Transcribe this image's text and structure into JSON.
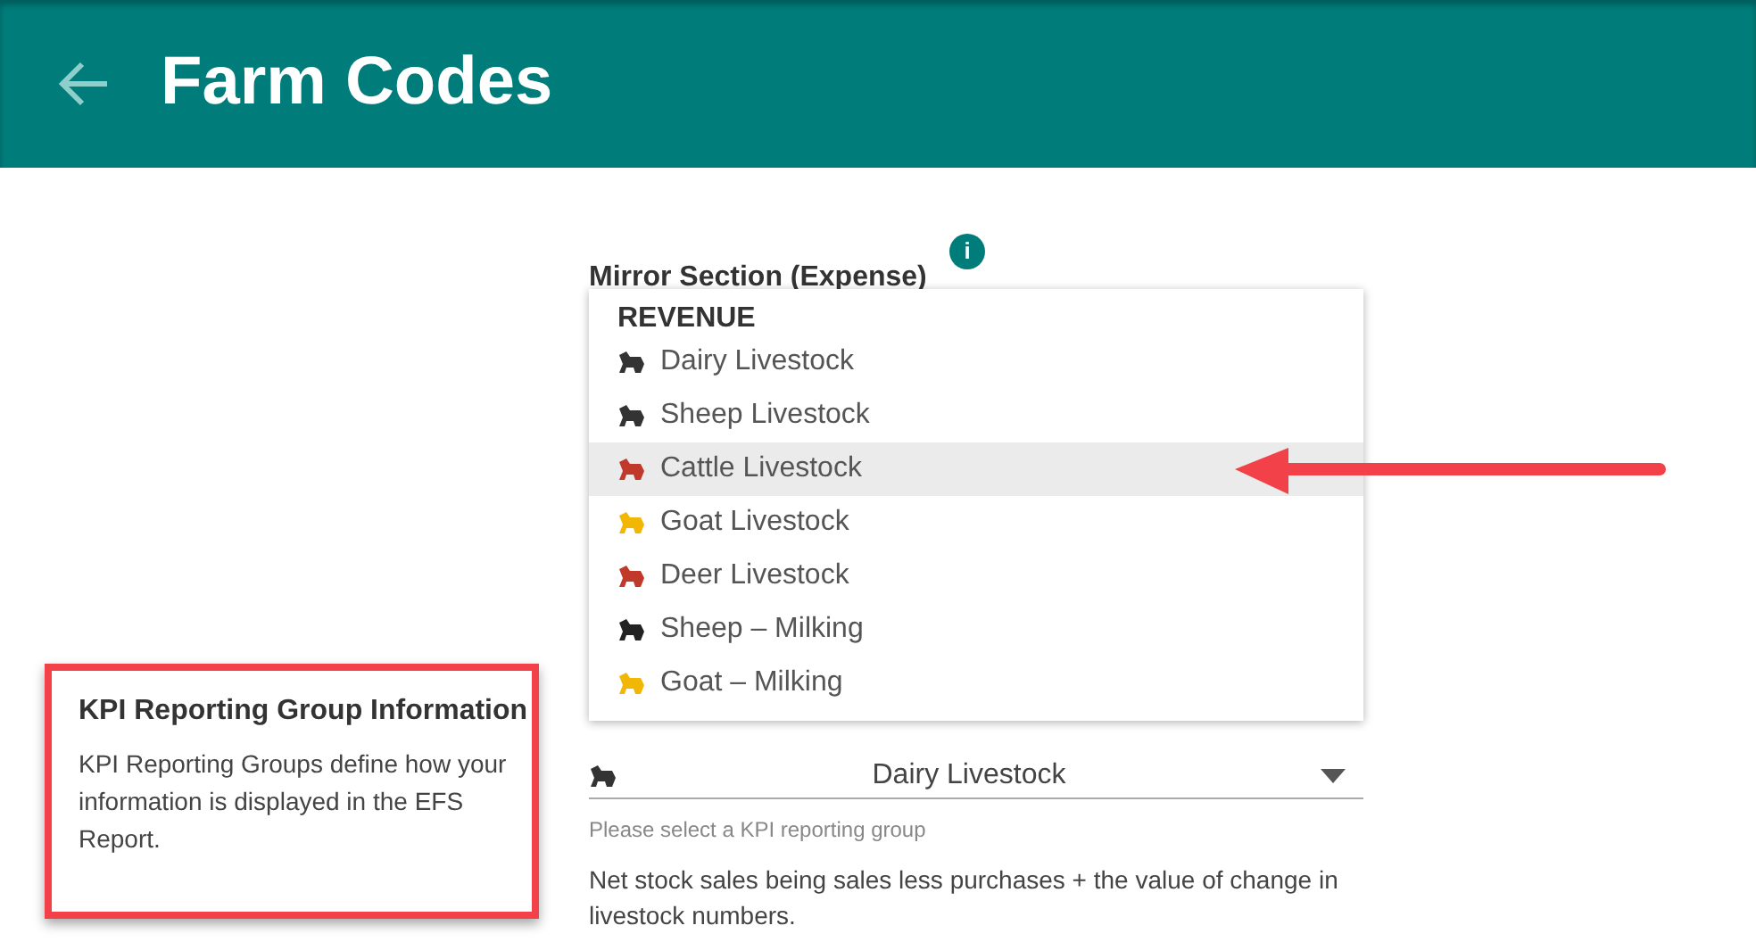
{
  "header": {
    "title": "Farm Codes"
  },
  "field": {
    "label": "Mirror Section (Expense)",
    "info_icon": "i"
  },
  "menu": {
    "group": "REVENUE",
    "items": [
      {
        "label": "Dairy Livestock",
        "color": "#333333",
        "selected": false
      },
      {
        "label": "Sheep Livestock",
        "color": "#333333",
        "selected": false
      },
      {
        "label": "Cattle Livestock",
        "color": "#c0392b",
        "selected": true
      },
      {
        "label": "Goat Livestock",
        "color": "#f2b705",
        "selected": false
      },
      {
        "label": "Deer Livestock",
        "color": "#c0392b",
        "selected": false
      },
      {
        "label": "Sheep – Milking",
        "color": "#222222",
        "selected": false
      },
      {
        "label": "Goat – Milking",
        "color": "#f2b705",
        "selected": false
      }
    ]
  },
  "select": {
    "value": "Dairy Livestock",
    "helper": "Please select a KPI reporting group",
    "description": "Net stock sales being sales less purchases + the value of change in livestock numbers."
  },
  "info_box": {
    "title": "KPI Reporting Group Information",
    "body": "KPI Reporting Groups define how your information is displayed in the EFS Report."
  }
}
